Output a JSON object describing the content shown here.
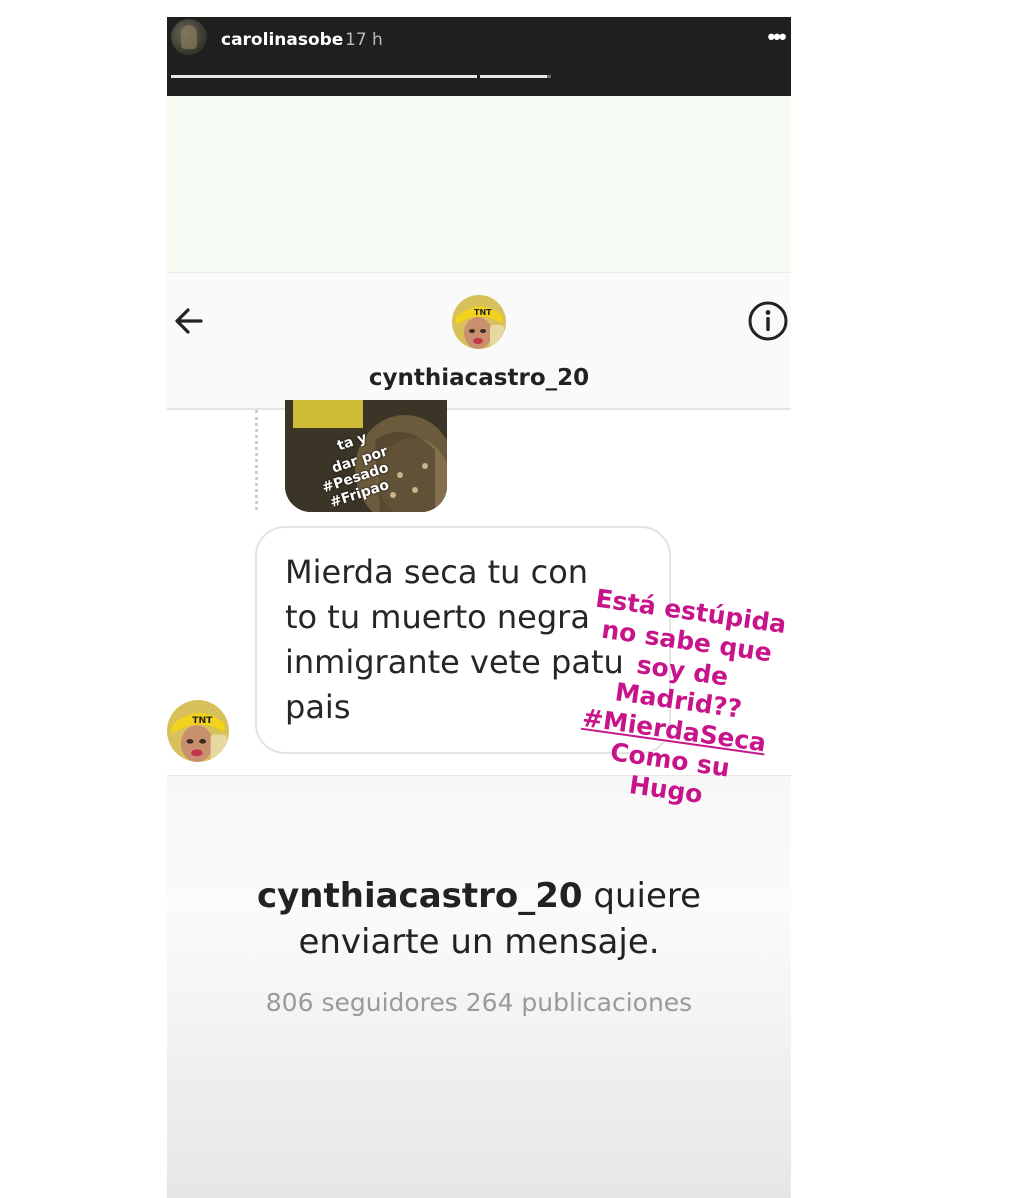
{
  "story": {
    "username": "carolinasobe",
    "time": "17 h",
    "more_icon": "more-dots-icon",
    "progress": [
      {
        "fill": 1.0
      },
      {
        "fill": 0.95
      }
    ]
  },
  "dm": {
    "back_icon": "back-arrow-icon",
    "info_icon": "info-icon",
    "username": "cynthiacastro_20"
  },
  "shared_post": {
    "text_lines": [
      "ta y",
      "dar por",
      "#Pesado",
      "#Fripao"
    ]
  },
  "message": {
    "text": "Mierda seca tu con\nto tu muerto negra\ninmigrante vete patu\npais"
  },
  "request": {
    "username": "cynthiacastro_20",
    "line1_suffix": " quiere",
    "line2": "enviarte un mensaje.",
    "stats": "806 seguidores 264 publicaciones"
  },
  "sticker": {
    "lines": [
      "Está estúpida",
      "no sabe que",
      "soy de",
      "Madrid??",
      "#MierdaSeca",
      "Como su",
      "Hugo"
    ],
    "color": "#c7148a"
  }
}
